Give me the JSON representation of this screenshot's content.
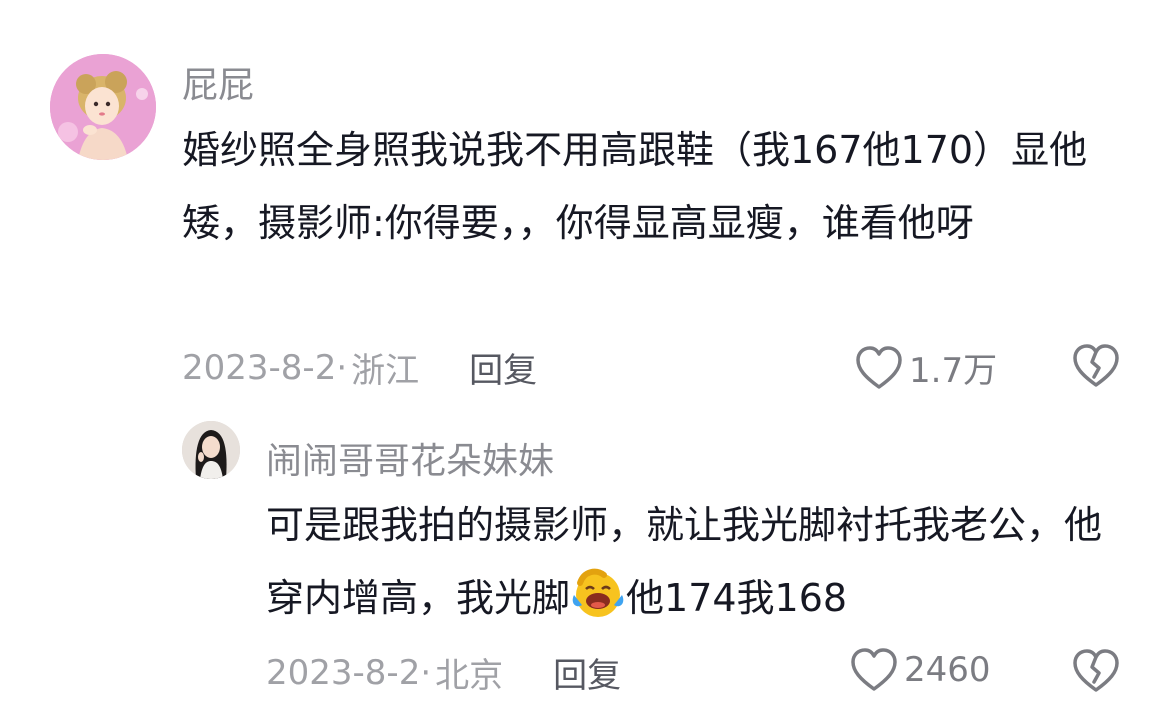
{
  "comments": [
    {
      "username": "屁屁",
      "text": "婚纱照全身照我说我不用高跟鞋（我167他170）显他矮，摄影师:你得要，，你得显高显瘦，谁看他呀",
      "date": "2023-8-2·",
      "location": "浙江",
      "reply_label": "回复",
      "likes": "1.7万",
      "avatar_icon": "cartoon-girl-avatar"
    }
  ],
  "reply": {
    "username": "闹闹哥哥花朵妹妹",
    "text_before_emoji": "可是跟我拍的摄影师，就让我光脚衬托我老公，他穿内增高，我光脚",
    "emoji_icon": "crying-laughing-face-emoji",
    "text_after_emoji": "他174我168",
    "date": "2023-8-2·",
    "location": "北京",
    "reply_label": "回复",
    "likes": "2460",
    "avatar_icon": "woman-photo-avatar"
  },
  "colors": {
    "text": "#161823",
    "username": "#8a8b91",
    "meta": "#a0a1a6",
    "icon": "#7b7c82"
  }
}
